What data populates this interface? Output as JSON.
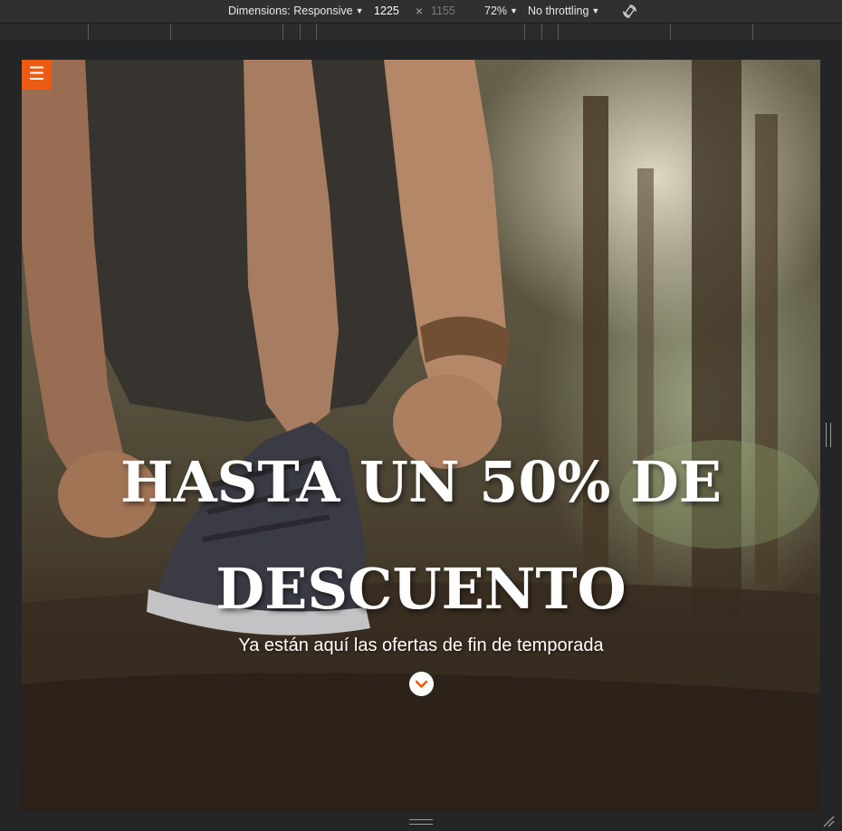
{
  "devtools": {
    "dimensions_label": "Dimensions: Responsive",
    "width_value": "1225",
    "times_symbol": "×",
    "height_value": "1155",
    "zoom_label": "72%",
    "throttling_label": "No throttling",
    "rotate_icon": "rotate-icon",
    "dropdown_icon": "caret-down-icon"
  },
  "page": {
    "menu_icon_glyph": "☰",
    "hero": {
      "title": "HASTA UN 50% DE DESCUENTO",
      "subtitle": "Ya están aquí las ofertas de fin de temporada",
      "scroll_icon": "chevron-down-icon"
    }
  },
  "colors": {
    "accent": "#ec5b13",
    "toolbar_bg": "#2f3032",
    "devtools_bg": "#242526"
  }
}
